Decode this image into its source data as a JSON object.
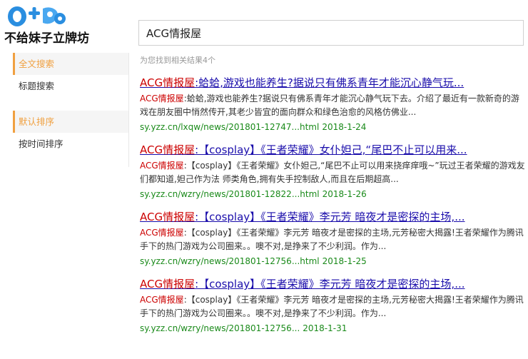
{
  "logo": {
    "graphic_text": "0+",
    "tagline": "不给妹子立牌坊"
  },
  "search": {
    "query": "ACG情报屋"
  },
  "result_count": "为您找到相关结果4个",
  "sidebar": {
    "groups": [
      {
        "items": [
          {
            "label": "全文搜索",
            "active": true
          },
          {
            "label": "标题搜索",
            "active": false
          }
        ]
      },
      {
        "items": [
          {
            "label": "默认排序",
            "active": true
          },
          {
            "label": "按时间排序",
            "active": false
          }
        ]
      }
    ]
  },
  "results": [
    {
      "title_hl": "ACG情报屋",
      "title_rest": ":蛤蛤,游戏也能养生?据说只有佛系青年才能沉心静气玩...",
      "snippet_hl": "ACG情报屋",
      "snippet_rest": ":蛤蛤,游戏也能养生?据说只有佛系青年才能沉心静气玩下去。介绍了最近有一款新奇的游戏在朋友圈中悄然传开,其老少皆宜的面向群众和绿色治愈的风格仿佛业...",
      "url": "sy.yzz.cn/lxqw/news/201801-12747...html",
      "date": "2018-1-24"
    },
    {
      "title_hl": "ACG情报屋",
      "title_rest": ":【cosplay】《王者荣耀》女仆妲己,“尾巴不止可以用来...",
      "snippet_hl": "ACG情报屋",
      "snippet_rest": ":【cosplay】《王者荣耀》女仆妲己,“尾巴不止可以用来挠痒痒哦~”玩过王者荣耀的游戏友们都知道,妲己作为法 师类角色,拥有失手控制敌人,而且在后期超高...",
      "url": "sy.yzz.cn/wzry/news/201801-12822...html",
      "date": "2018-1-26"
    },
    {
      "title_hl": "ACG情报屋",
      "title_rest": ":【cosplay】《王者荣耀》李元芳 暗夜才是密探的主场,...",
      "snippet_hl": "ACG情报屋",
      "snippet_rest": ":【cosplay】《王者荣耀》李元芳 暗夜才是密探的主场,元芳秘密大揭露!王者荣耀作为腾讯手下的热门游戏为公司圈来。。噢不对,是挣来了不少利润。作为...",
      "url": "sy.yzz.cn/wzry/news/201801-12756...html",
      "date": "2018-1-25"
    },
    {
      "title_hl": "ACG情报屋",
      "title_rest": ":【cosplay】《王者荣耀》李元芳 暗夜才是密探的主场,...",
      "snippet_hl": "ACG情报屋",
      "snippet_rest": ":【cosplay】《王者荣耀》李元芳 暗夜才是密探的主场,元芳秘密大揭露!王者荣耀作为腾讯手下的热门游戏为公司圈来。。噢不对,是挣来了不少利润。作为...",
      "url": "sy.yzz.cn/wzry/news/201801-12756...",
      "date": "2018-1-31"
    }
  ],
  "colors": {
    "link": "#1a0dab",
    "highlight": "#cc0000",
    "url": "#1a8a1a",
    "sidebar_active": "#f0a040",
    "logo_blue": "#2a8ee0"
  }
}
